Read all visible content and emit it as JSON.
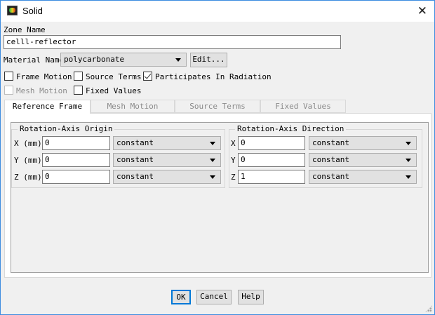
{
  "window": {
    "title": "Solid",
    "close_icon": "close-icon"
  },
  "zone_name": {
    "label": "Zone Name",
    "value": "celll-reflector"
  },
  "material": {
    "label": "Material Name",
    "value": "polycarbonate",
    "edit_label": "Edit..."
  },
  "checkboxes": [
    {
      "label": "Frame Motion",
      "checked": false,
      "enabled": true
    },
    {
      "label": "Source Terms",
      "checked": false,
      "enabled": true
    },
    {
      "label": "Participates In Radiation",
      "checked": true,
      "enabled": true
    },
    {
      "label": "Mesh Motion",
      "checked": false,
      "enabled": false
    },
    {
      "label": "Fixed Values",
      "checked": false,
      "enabled": true
    }
  ],
  "tabs": [
    {
      "label": "Reference Frame",
      "active": true
    },
    {
      "label": "Mesh Motion"
    },
    {
      "label": "Source Terms"
    },
    {
      "label": "Fixed Values"
    }
  ],
  "origin": {
    "title": "Rotation-Axis Origin",
    "rows": [
      {
        "label": "X (mm)",
        "value": "0",
        "method": "constant"
      },
      {
        "label": "Y (mm)",
        "value": "0",
        "method": "constant"
      },
      {
        "label": "Z (mm)",
        "value": "0",
        "method": "constant"
      }
    ]
  },
  "direction": {
    "title": "Rotation-Axis Direction",
    "rows": [
      {
        "label": "X",
        "value": "0",
        "method": "constant"
      },
      {
        "label": "Y",
        "value": "0",
        "method": "constant"
      },
      {
        "label": "Z",
        "value": "1",
        "method": "constant"
      }
    ]
  },
  "buttons": {
    "ok": "OK",
    "cancel": "Cancel",
    "help": "Help"
  }
}
